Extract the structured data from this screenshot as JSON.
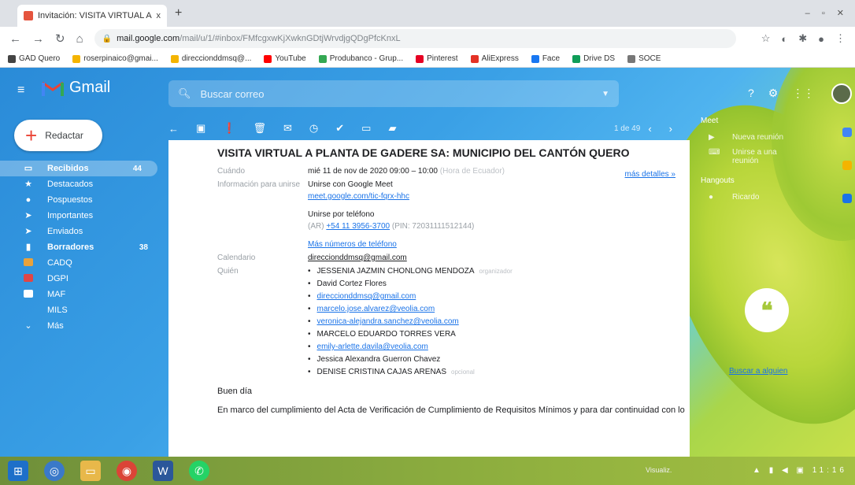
{
  "browser": {
    "tab_title": "Invitación: VISITA VIRTUAL A PL",
    "tab_close": "x",
    "new_tab": "+",
    "address_host": "mail.google.com",
    "address_path": "/mail/u/1/#inbox/FMfcgxwKjXwknGDtjWrvdjgQDgPfcKnxL",
    "bookmarks": [
      {
        "label": "GAD Quero",
        "color": "#444444"
      },
      {
        "label": "roserpinaico@gmai...",
        "color": "#f4b400"
      },
      {
        "label": "direccionddmsq@...",
        "color": "#f4b400"
      },
      {
        "label": "YouTube",
        "color": "#ff0000"
      },
      {
        "label": "Produbanco - Grup...",
        "color": "#34a853"
      },
      {
        "label": "Pinterest",
        "color": "#e60023"
      },
      {
        "label": "AliExpress",
        "color": "#e43225"
      },
      {
        "label": "Face",
        "color": "#1877f2"
      },
      {
        "label": "Drive DS",
        "color": "#0f9d58"
      },
      {
        "label": "SOCE",
        "color": "#777777"
      }
    ]
  },
  "gmail": {
    "logo_text": "Gmail",
    "search_placeholder": "Buscar correo",
    "compose_label": "Redactar",
    "sidebar": [
      {
        "label": "Recibidos",
        "count": "44",
        "icon": "inbox-icon",
        "glyph": "▭",
        "active": true
      },
      {
        "label": "Destacados",
        "count": "",
        "icon": "star-icon",
        "glyph": "★"
      },
      {
        "label": "Pospuestos",
        "count": "",
        "icon": "clock-icon",
        "glyph": "●"
      },
      {
        "label": "Importantes",
        "count": "",
        "icon": "important-icon",
        "glyph": "➤"
      },
      {
        "label": "Enviados",
        "count": "",
        "icon": "send-icon",
        "glyph": "➤"
      },
      {
        "label": "Borradores",
        "count": "38",
        "icon": "draft-icon",
        "glyph": "▮",
        "bold": true
      },
      {
        "label": "CADQ",
        "count": "",
        "icon": "label-icon",
        "color": "#e9a23b"
      },
      {
        "label": "DGPI",
        "count": "",
        "icon": "label-icon",
        "color": "#e04646"
      },
      {
        "label": "MAF",
        "count": "",
        "icon": "label-icon",
        "color": "#ffffff"
      },
      {
        "label": "MILS",
        "count": "",
        "icon": "",
        "glyph": ""
      },
      {
        "label": "Más",
        "count": "",
        "icon": "chevron-down-icon",
        "glyph": "⌄"
      }
    ],
    "pager": "1 de 49"
  },
  "email": {
    "subject": "VISITA VIRTUAL A PLANTA DE GADERE SA: MUNICIPIO DEL CANTÓN QUERO",
    "when_label": "Cuándo",
    "when_value": "mié 11 de nov de 2020 09:00 – 10:00",
    "when_tz": "(Hora de Ecuador)",
    "more_details": "más detalles »",
    "join_label": "Información para unirse",
    "join_meet": "Unirse con Google Meet",
    "meet_link": "meet.google.com/tic-fqrx-hhc",
    "join_phone": "Unirse por teléfono",
    "phone_prefix": "(AR)",
    "phone_number": "+54 11 3956-3700",
    "phone_pin": "(PIN: 72031111512144)",
    "more_phones": "Más números de teléfono",
    "calendar_label": "Calendario",
    "calendar_value": "direccionddmsq@gmail.com",
    "who_label": "Quién",
    "guests": [
      {
        "name": "JESSENIA JAZMIN CHONLONG MENDOZA",
        "role": "organizador",
        "link": false
      },
      {
        "name": "David Cortez Flores",
        "role": "",
        "link": false
      },
      {
        "name": "direccionddmsq@gmail.com",
        "role": "",
        "link": true
      },
      {
        "name": "marcelo.jose.alvarez@veolia.com",
        "role": "",
        "link": true
      },
      {
        "name": "veronica-alejandra.sanchez@veolia.com",
        "role": "",
        "link": true
      },
      {
        "name": "MARCELO EDUARDO TORRES VERA",
        "role": "",
        "link": false
      },
      {
        "name": "emily-arlette.davila@veolia.com",
        "role": "",
        "link": true
      },
      {
        "name": "Jessica Alexandra Guerron Chavez",
        "role": "",
        "link": false
      },
      {
        "name": "DENISE CRISTINA CAJAS ARENAS",
        "role": "opcional",
        "link": false
      }
    ],
    "greeting": "Buen día",
    "body_line": "En marco del cumplimiento del Acta de Verificación de Cumplimiento de Requisitos Mínimos y para dar continuidad con lo"
  },
  "right_panel": {
    "meet_title": "Meet",
    "new_meeting": "Nueva reunión",
    "join_meeting": "Unirse a una reunión",
    "hangouts_title": "Hangouts",
    "hangouts_user": "Ricardo",
    "start_hangout": "Buscar a alguien"
  },
  "taskbar": {
    "tray_text": "Visualiz.",
    "clock": "11:16"
  }
}
